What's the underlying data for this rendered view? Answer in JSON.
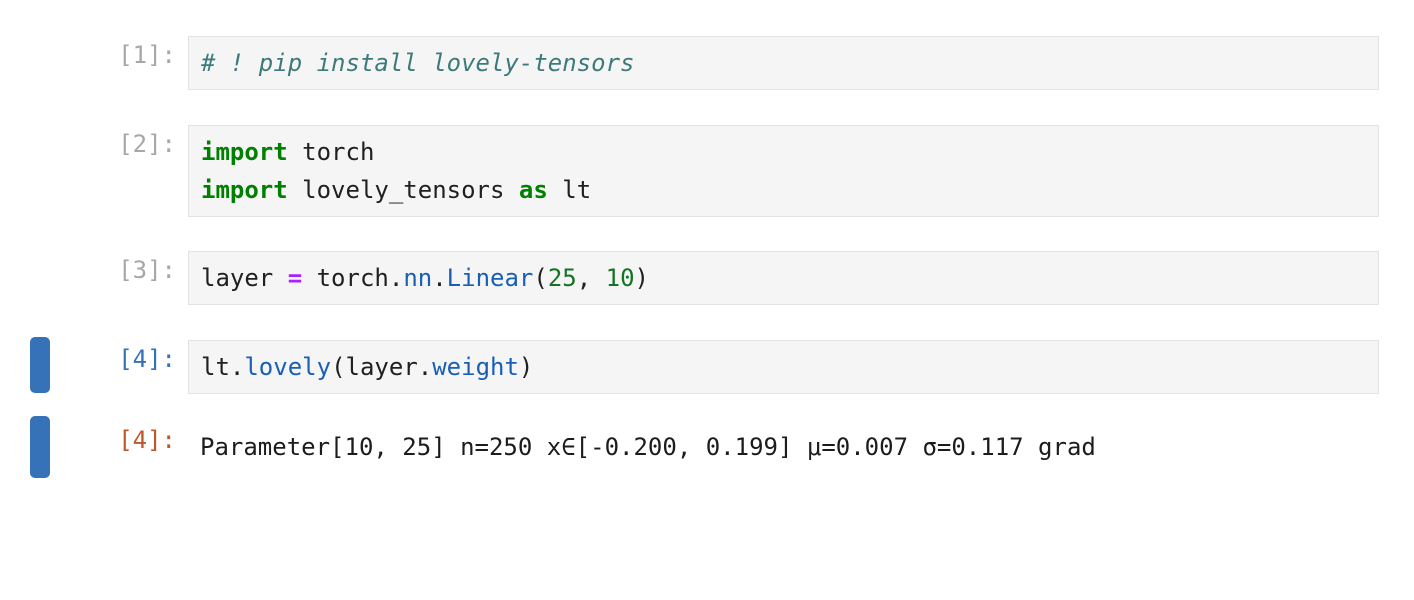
{
  "app": {
    "kind": "jupyter-notebook",
    "background": "#ffffff"
  },
  "colors": {
    "selection_bar": "#3572b8",
    "prompt_idle": "#a7a7a7",
    "prompt_active": "#3572b8",
    "prompt_output": "#c1562b",
    "cell_background": "#f5f5f5",
    "cell_border": "#e3e3e3",
    "comment": "#3d7b7b",
    "keyword": "#008000",
    "function": "#1a5fb4",
    "number": "#157322",
    "operator": "#aa22ff",
    "text": "#202020"
  },
  "cells": [
    {
      "prompt": "[1]:",
      "prompt_state": "idle",
      "selected": false,
      "lines": [
        [
          {
            "t": "# ! pip install lovely-tensors",
            "c": "comment"
          }
        ]
      ]
    },
    {
      "prompt": "[2]:",
      "prompt_state": "idle",
      "selected": false,
      "lines": [
        [
          {
            "t": "import",
            "c": "kw"
          },
          {
            "t": " torch",
            "c": "name"
          }
        ],
        [
          {
            "t": "import",
            "c": "kw"
          },
          {
            "t": " lovely_tensors ",
            "c": "name"
          },
          {
            "t": "as",
            "c": "kw"
          },
          {
            "t": " lt",
            "c": "name"
          }
        ]
      ]
    },
    {
      "prompt": "[3]:",
      "prompt_state": "idle",
      "selected": false,
      "lines": [
        [
          {
            "t": "layer ",
            "c": "name"
          },
          {
            "t": "=",
            "c": "op"
          },
          {
            "t": " torch.",
            "c": "name"
          },
          {
            "t": "nn",
            "c": "fn"
          },
          {
            "t": ".",
            "c": "punct"
          },
          {
            "t": "Linear",
            "c": "fn"
          },
          {
            "t": "(",
            "c": "punct"
          },
          {
            "t": "25",
            "c": "num"
          },
          {
            "t": ", ",
            "c": "punct"
          },
          {
            "t": "10",
            "c": "num"
          },
          {
            "t": ")",
            "c": "punct"
          }
        ]
      ]
    },
    {
      "prompt": "[4]:",
      "prompt_state": "active",
      "selected": true,
      "lines": [
        [
          {
            "t": "lt.",
            "c": "name"
          },
          {
            "t": "lovely",
            "c": "fn"
          },
          {
            "t": "(",
            "c": "punct"
          },
          {
            "t": "layer.",
            "c": "name"
          },
          {
            "t": "weight",
            "c": "fn"
          },
          {
            "t": ")",
            "c": "punct"
          }
        ]
      ]
    }
  ],
  "output": {
    "prompt": "[4]:",
    "selected": true,
    "text": "Parameter[10, 25] n=250 x∈[-0.200, 0.199] μ=0.007 σ=0.117 grad",
    "fields": {
      "type": "Parameter",
      "shape": "[10, 25]",
      "n": "250",
      "range": "x∈[-0.200, 0.199]",
      "min": "-0.200",
      "max": "0.199",
      "mean": "μ=0.007",
      "std": "σ=0.117",
      "flag": "grad"
    }
  }
}
